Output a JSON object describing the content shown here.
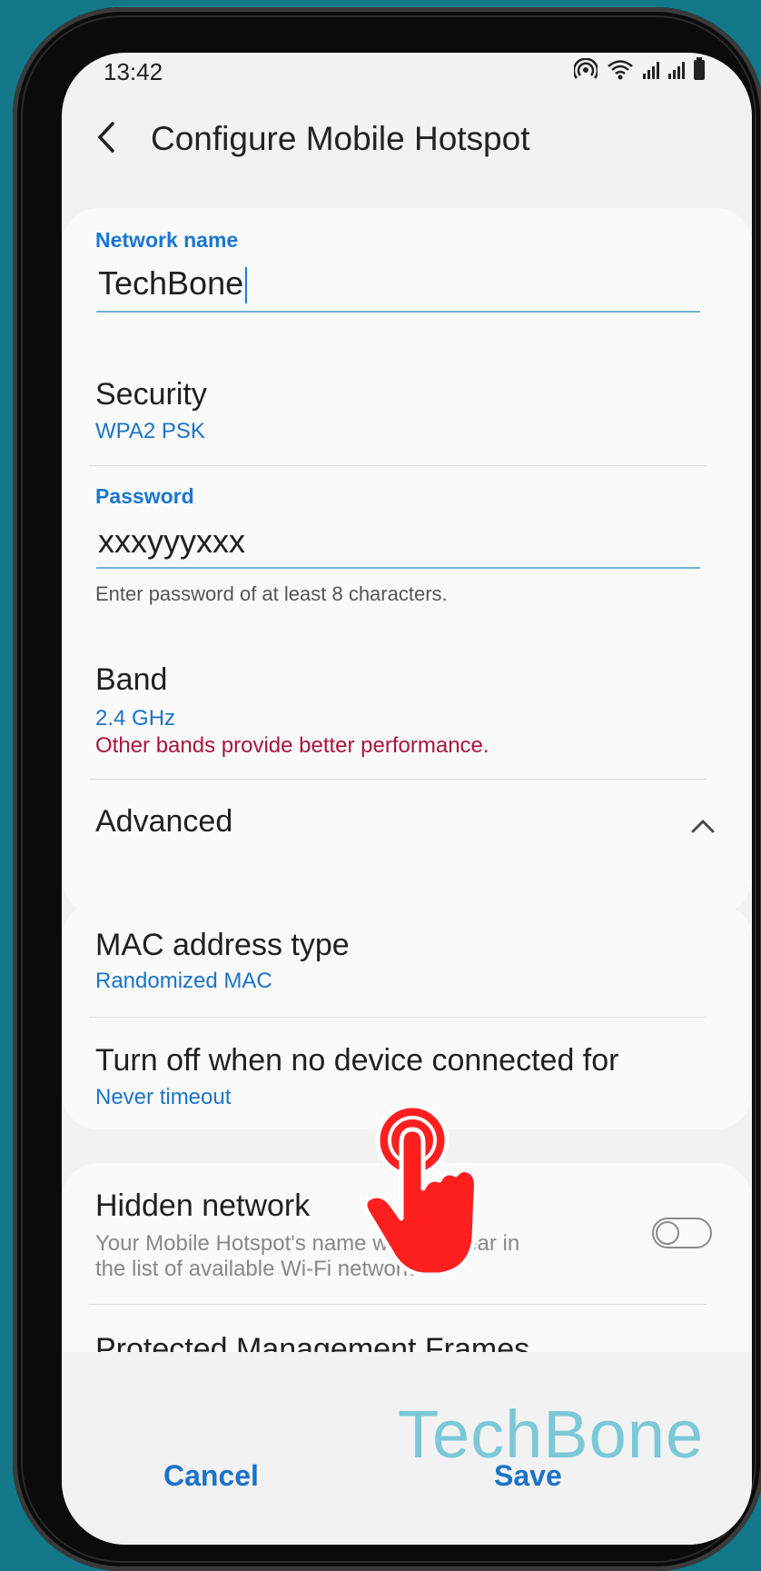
{
  "status_bar": {
    "time": "13:42",
    "icons": [
      "hotspot-icon",
      "wifi-icon",
      "signal-icon",
      "signal-icon",
      "battery-icon"
    ]
  },
  "header": {
    "back_icon": "chevron-left-icon",
    "title": "Configure Mobile Hotspot"
  },
  "form": {
    "network_name_label": "Network name",
    "network_name_value": "TechBone",
    "security_title": "Security",
    "security_value": "WPA2 PSK",
    "password_label": "Password",
    "password_value": "xxxyyyxxx",
    "password_helper": "Enter password of at least 8 characters.",
    "band_title": "Band",
    "band_value": "2.4 GHz",
    "band_warning": "Other bands provide better performance.",
    "advanced_title": "Advanced",
    "advanced_icon": "chevron-up-icon"
  },
  "advanced": {
    "mac_title": "MAC address type",
    "mac_value": "Randomized MAC",
    "timeout_title": "Turn off when no device connected for",
    "timeout_value": "Never timeout",
    "hidden_title": "Hidden network",
    "hidden_desc_1": "Your Mobile Hotspot's name won't appear in",
    "hidden_desc_2": "the list of available Wi-Fi networks.",
    "hidden_enabled": false,
    "pmf_title": "Protected Management Frames"
  },
  "actions": {
    "cancel_label": "Cancel",
    "save_label": "Save"
  },
  "watermark": "TechBone",
  "colors": {
    "accent_blue": "#1a73c9",
    "warning_red": "#a8163c",
    "background_teal": "#13798a",
    "tap_hand_red": "#ff1f1f"
  }
}
